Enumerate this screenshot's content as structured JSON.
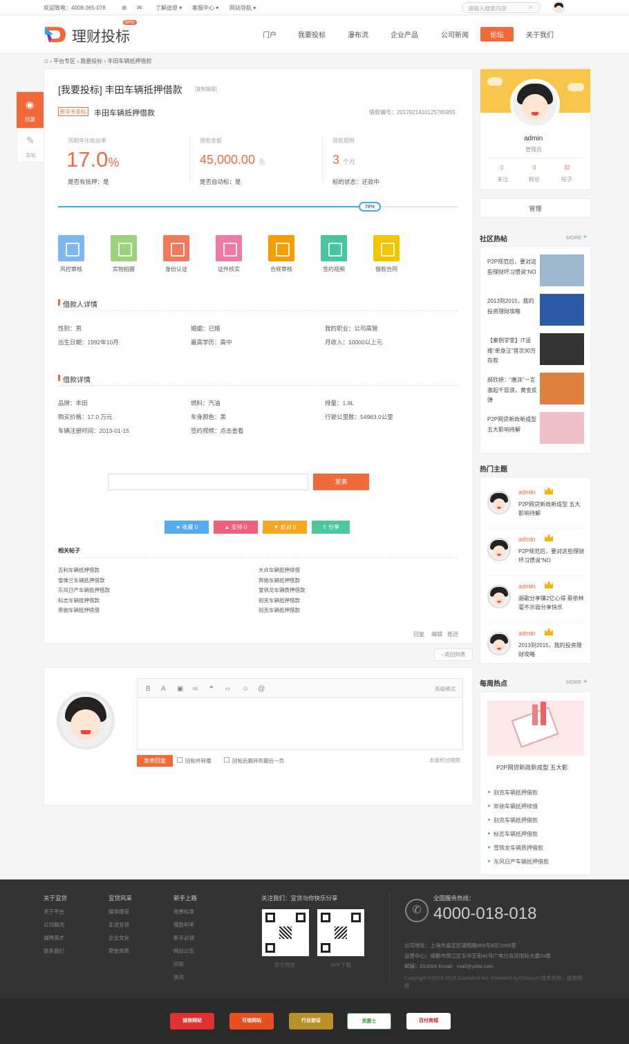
{
  "topbar": {
    "hotline": "欢迎致电：4008-365-078",
    "menu1": "了解途恩",
    "menu2": "客服中心",
    "menu3": "网站导航",
    "search_placeholder": "请输入搜索内容"
  },
  "header": {
    "logo": "理财投标",
    "beta": "beta",
    "nav": [
      "门户",
      "我要投标",
      "瀑布流",
      "企业产品",
      "公司新闻",
      "论坛",
      "关于我们"
    ]
  },
  "breadcrumb": [
    "平台专区",
    "我要投标",
    "丰田车辆抵押借款"
  ],
  "float": {
    "reply": "回复",
    "post": "发帖"
  },
  "loan": {
    "title": "[我要投标] 丰田车辆抵押借款",
    "copy": "[复制链接]",
    "tag": "新手专享标",
    "name": "丰田车辆抵押借款",
    "code": "借款编号：2017021410125765955",
    "rate_label": "预期年化收益率",
    "rate_value": "17.0",
    "rate_unit": "%",
    "pledge": "是否有抵押：是",
    "amount_label": "借款金额",
    "amount_value": "45,000.00",
    "amount_unit": "元",
    "auto": "是否自动标：是",
    "term_label": "借款期限",
    "term_value": "3",
    "term_unit": "个月",
    "status": "标的状态：还款中",
    "progress": 0.78,
    "progress_text": "78%"
  },
  "audit": [
    "风控审核",
    "实物拍摄",
    "身份认证",
    "证件核实",
    "合规审核",
    "签约视频",
    "借款合同"
  ],
  "audit_colors": [
    "#7db6f0",
    "#9bd27a",
    "#f07a5a",
    "#f07aa6",
    "#f5a000",
    "#45c8a0",
    "#f5c400"
  ],
  "borrower": {
    "title": "借款人详情",
    "gender": "性别：男",
    "birth": "出生日期：1992年10月",
    "marriage": "婚姻：已婚",
    "edu": "最高学历：高中",
    "job": "我的职业：公司高管",
    "income": "月收入：10000以上元"
  },
  "detail": {
    "title": "借款详情",
    "brand": "品牌：丰田",
    "price": "购买价格：17.0 万元",
    "reg": "车辆注册时间：2013-01-15",
    "fuel": "燃料：汽油",
    "color": "车身颜色：黑",
    "video": "签约视频：点击查看",
    "disp": "排量：1.9L",
    "km": "行驶公里数：54963.0公里"
  },
  "actions": {
    "submit": "发表",
    "fav": "收藏 0",
    "support": "支持 0",
    "oppose": "反对 0",
    "share": "分享"
  },
  "related": {
    "title": "相关帖子",
    "left": [
      "吉利车辆抵押借款",
      "雪佛兰车辆抵押借款",
      "东风日产车辆抵押借款",
      "标志车辆抵押借款",
      "奔驰车辆抵押续借"
    ],
    "right": [
      "大众车辆抵押续借",
      "奔驰车辆抵押借款",
      "雪铁龙车辆质押借款",
      "别克车辆抵押借款",
      "别克车辆抵押借款"
    ]
  },
  "post_ops": {
    "reply": "回复",
    "edit": "编辑",
    "push": "推送"
  },
  "back": "返回列表",
  "editor": {
    "advanced": "高级模式",
    "submit": "发表回复",
    "opt1": "回帖并转播",
    "opt2": "回帖后跳转到最后一页",
    "rules": "本版积分规则"
  },
  "profile": {
    "name": "admin",
    "role": "管理员",
    "stats": [
      {
        "n": "0",
        "l": "关注"
      },
      {
        "n": "0",
        "l": "粉丝"
      },
      {
        "n": "32",
        "l": "帖子"
      }
    ],
    "manage": "管理"
  },
  "hot": {
    "title": "社区热帖",
    "more": "MORE",
    "items": [
      "P2P规范后，要对这些理财坏习惯说“NO",
      "2013到2015，我的投资理财攻略",
      "【案例学堂】IT运维“单身汪”首次30万存款",
      "郝欣妍：“唐派”一言激起千层浪，黄金反弹",
      "P2P网贷新政新成型 五大影响待解"
    ]
  },
  "topics": {
    "title": "热门主题",
    "items": [
      {
        "a": "admin",
        "t": "P2P网贷新政新成型 五大影响待解"
      },
      {
        "a": "admin",
        "t": "P2P规范后，要对这些理财坏习惯说“NO"
      },
      {
        "a": "admin",
        "t": "胡歌分享赚2亿心得 蔡依林毫不示弱分享快乐"
      },
      {
        "a": "admin",
        "t": "2013到2015，我的投资理财攻略"
      }
    ]
  },
  "weekly": {
    "title": "每周热点",
    "more": "MORE",
    "caption": "P2P网贷新政新成型 五大影",
    "items": [
      "别克车辆抵押借款",
      "奔驰车辆抵押续借",
      "别克车辆抵押借款",
      "标志车辆抵押借款",
      "雪铁龙车辆质押借款",
      "东风日产车辆抵押借款"
    ]
  },
  "footer": {
    "cols": [
      {
        "h": "关于宜贷",
        "l": [
          "关于平台",
          "公司概况",
          "诚聘英才",
          "联系我们"
        ]
      },
      {
        "h": "宜贷风采",
        "l": [
          "媒体报道",
          "走进宜贷",
          "企业文化",
          "荣誉资质"
        ]
      },
      {
        "h": "新手上路",
        "l": [
          "收费标准",
          "借款利率",
          "新手必读",
          "网站公告",
          "问答",
          "资讯"
        ]
      }
    ],
    "follow": "关注我们：宜贷与你快乐分享",
    "qr1": "官方微信",
    "qr2": "APP下载",
    "hotline_label": "全国服务热线：",
    "hotline": "4000-018-018",
    "addr1": "公司地址：上海市嘉定区银翔路655号B区1068室",
    "addr2": "运营中心：成都市锦江区东华正街42号广电仕百达国际大厦25楼",
    "mail": "邮编：610066 Email：mail@yidai.com",
    "copy": "Copyright ©2015-2016 Comsenz Inc. Powered by©Discuz! 技术支持：途恩网络"
  },
  "badges": [
    "诚信网站",
    "可信网站",
    "行业验证",
    "资爵士",
    "百付商城"
  ]
}
